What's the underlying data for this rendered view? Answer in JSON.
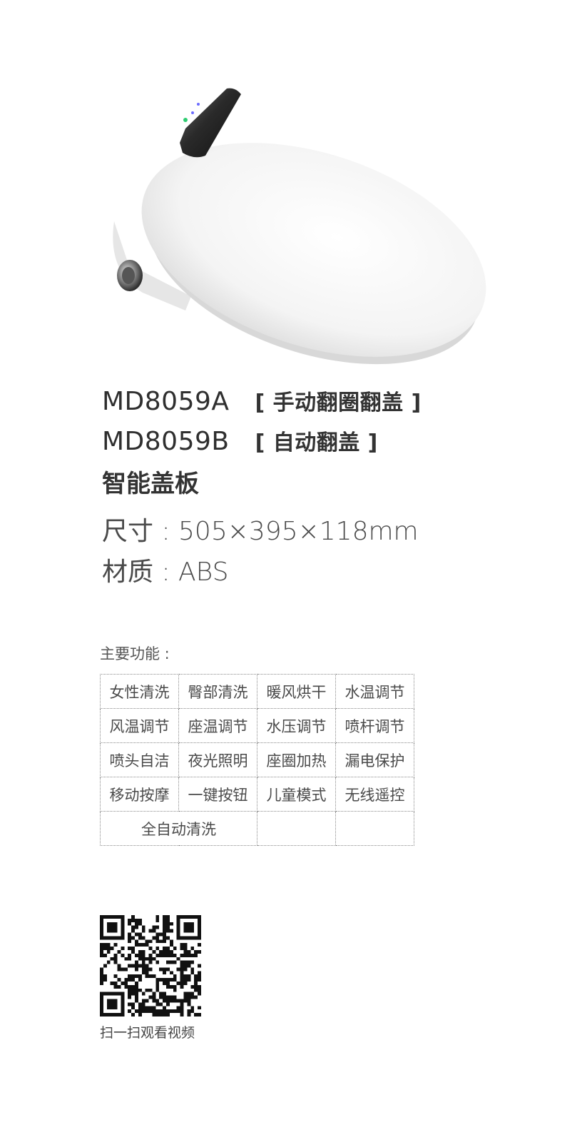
{
  "product": {
    "model_a": "MD8059A",
    "tag_a": "[ 手动翻圈翻盖 ]",
    "model_b": "MD8059B",
    "tag_b": "[ 自动翻盖 ]",
    "name": "智能盖板"
  },
  "specs": {
    "size": "尺寸 : 505×395×118mm",
    "material": "材质 : ABS"
  },
  "features": {
    "label": "主要功能 :",
    "rows": [
      [
        "女性清洗",
        "臀部清洗",
        "暖风烘干",
        "水温调节"
      ],
      [
        "风温调节",
        "座温调节",
        "水压调节",
        "喷杆调节"
      ],
      [
        "喷头自洁",
        "夜光照明",
        "座圈加热",
        "漏电保护"
      ],
      [
        "移动按摩",
        "一键按钮",
        "儿童模式",
        "无线遥控"
      ]
    ],
    "last_row": "全自动清洗"
  },
  "qr": {
    "caption": "扫一扫观看视频"
  }
}
